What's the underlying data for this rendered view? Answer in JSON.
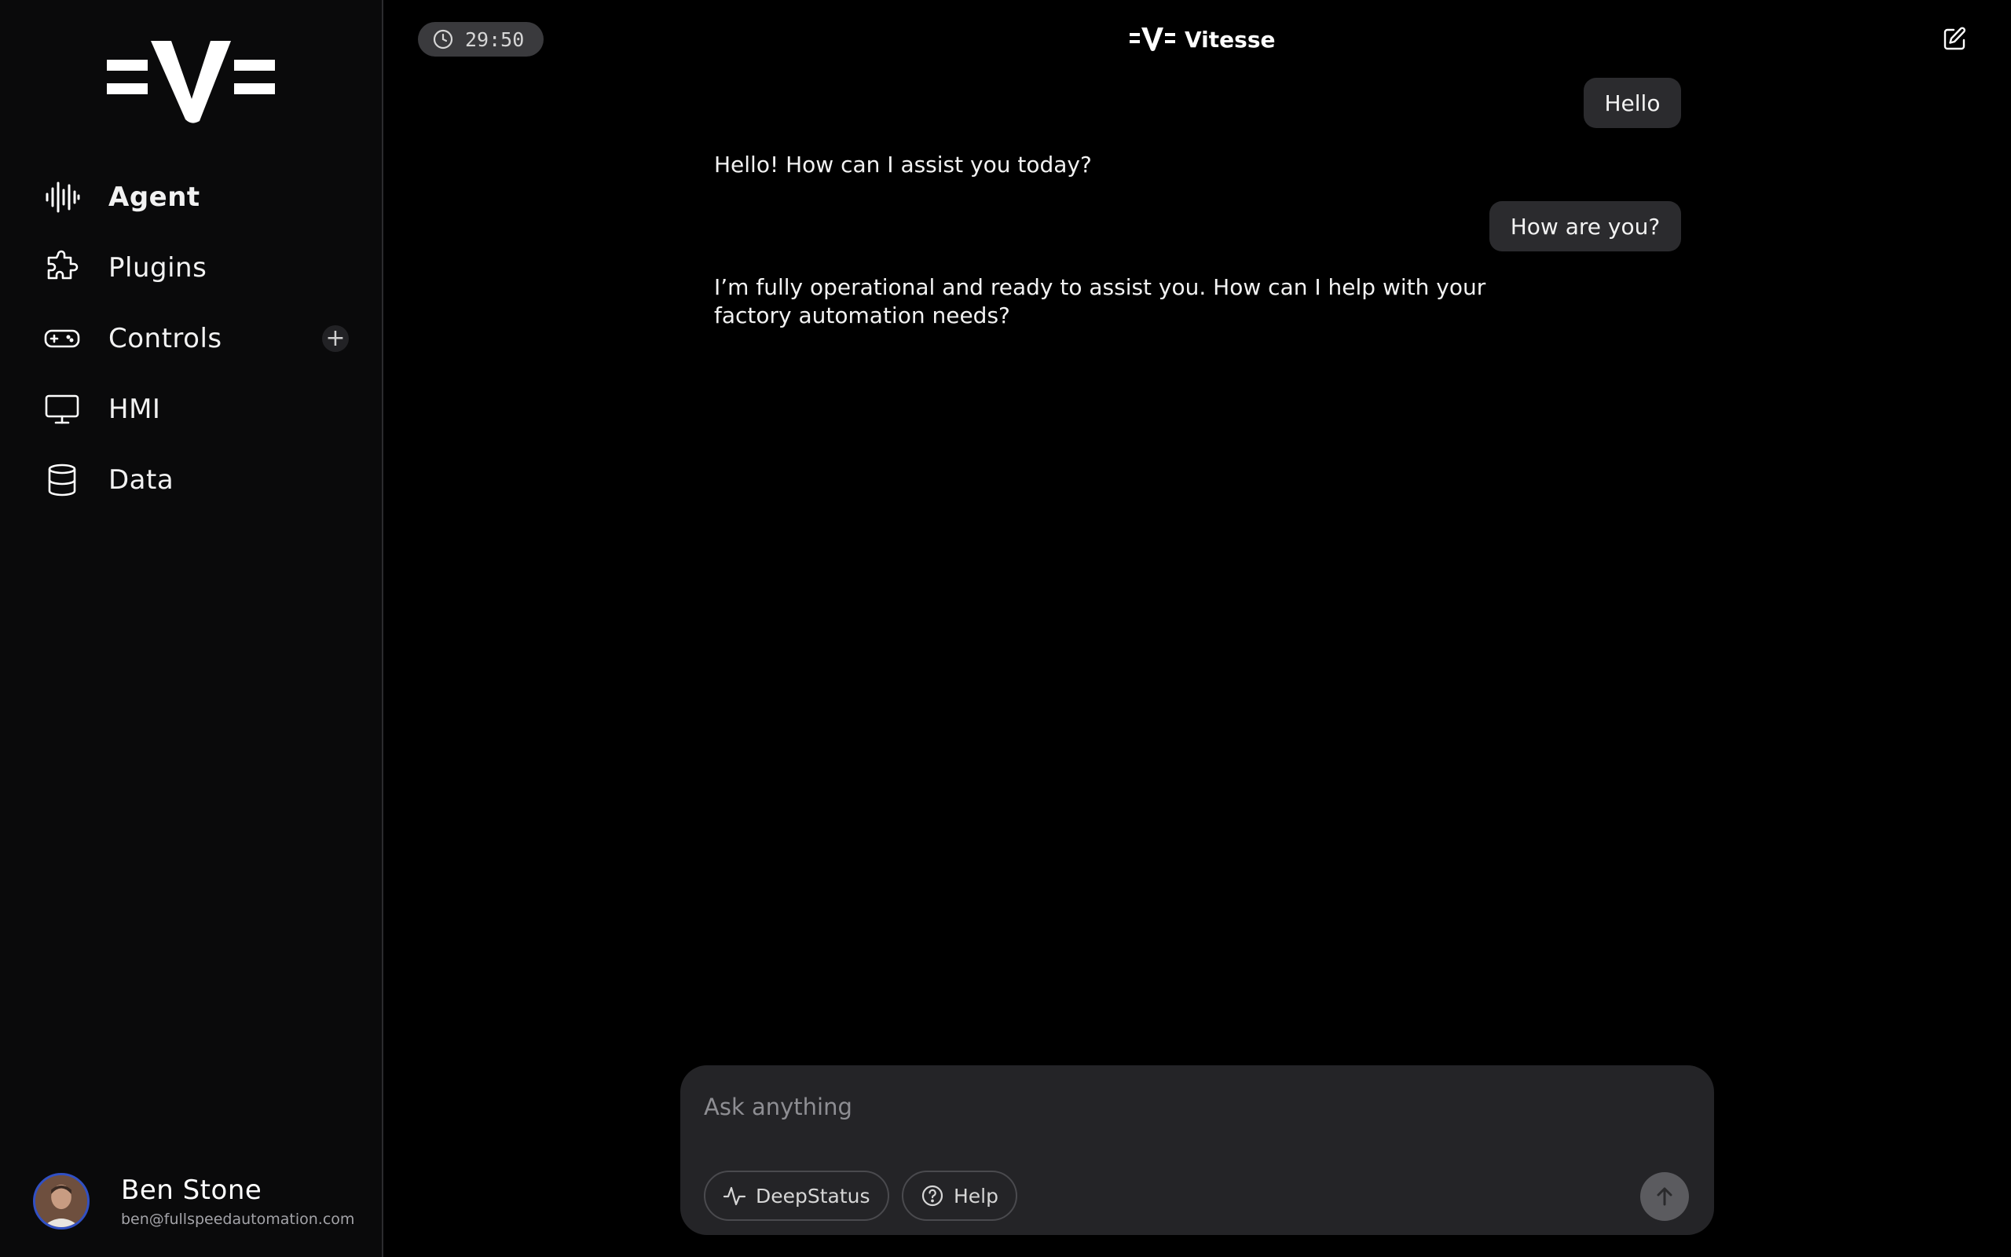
{
  "app": {
    "brand_name": "Vitesse"
  },
  "timer": {
    "value": "29:50"
  },
  "sidebar": {
    "items": [
      {
        "label": "Agent",
        "icon": "waveform-icon",
        "active": true
      },
      {
        "label": "Plugins",
        "icon": "puzzle-icon"
      },
      {
        "label": "Controls",
        "icon": "gamepad-icon",
        "add_label": "+"
      },
      {
        "label": "HMI",
        "icon": "monitor-icon"
      },
      {
        "label": "Data",
        "icon": "database-icon"
      }
    ]
  },
  "user": {
    "name": "Ben Stone",
    "email": "ben@fullspeedautomation.com"
  },
  "messages": [
    {
      "role": "user",
      "text": "Hello"
    },
    {
      "role": "assistant",
      "text": "Hello! How can I assist you today?"
    },
    {
      "role": "user",
      "text": "How are you?"
    },
    {
      "role": "assistant",
      "lines": [
        "I’m fully operational and ready to assist you. How can I help with your",
        "factory automation needs?"
      ]
    }
  ],
  "composer": {
    "placeholder": "Ask anything",
    "value": "",
    "deepstatus_label": "DeepStatus",
    "help_label": "Help"
  },
  "colors": {
    "background": "#000000",
    "sidebar": "#0a0a0b",
    "bubble": "#2b2b2e",
    "composer": "#242427",
    "avatar_ring": "#3150c4"
  }
}
